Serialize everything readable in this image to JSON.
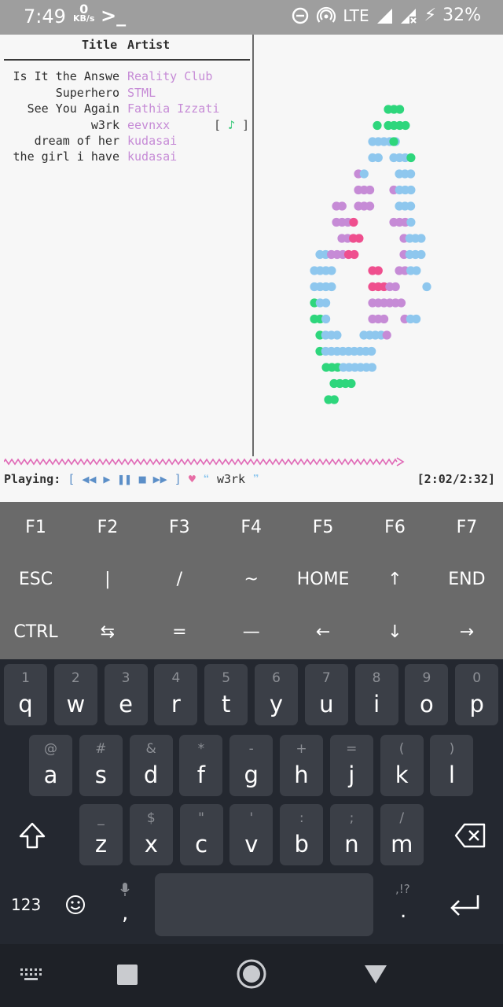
{
  "status_bar": {
    "time": "7:49",
    "net_speed": "0",
    "net_unit": "KB/s",
    "terminal_glyph": ">_",
    "network": "LTE",
    "battery": "32%"
  },
  "terminal": {
    "header": {
      "title": "Title",
      "artist": "Artist"
    },
    "rows": [
      {
        "title": "Is It the Answe",
        "artist": "Reality Club",
        "badge": ""
      },
      {
        "title": "Superhero",
        "artist": "STML",
        "badge": ""
      },
      {
        "title": "See You Again",
        "artist": "Fathia Izzati",
        "badge": ""
      },
      {
        "title": "w3rk",
        "artist": "eevnxx",
        "badge": "[ ♪ ]"
      },
      {
        "title": "dream of her",
        "artist": "kudasai",
        "badge": ""
      },
      {
        "title": "the girl i have",
        "artist": "kudasai",
        "badge": ""
      }
    ],
    "playing_label": "Playing:",
    "controls": "[ ◀◀ ▶ ❚❚ ■ ▶▶ ]",
    "heart": "♥",
    "open_quote": "❝",
    "current_title": "w3rk",
    "close_quote": "❞",
    "elapsed": "[2:02/2:32]",
    "colors": {
      "green": "#2ed67c",
      "blue": "#8ec7ee",
      "purple": "#c68bd6",
      "pink": "#ef4f8e"
    }
  },
  "extra_keys": {
    "row1": [
      "F1",
      "F2",
      "F3",
      "F4",
      "F5",
      "F6",
      "F7"
    ],
    "row2": [
      "ESC",
      "|",
      "/",
      "~",
      "HOME",
      "↑",
      "END"
    ],
    "row3": [
      "CTRL",
      "⇆",
      "=",
      "—",
      "←",
      "↓",
      "→"
    ]
  },
  "keyboard": {
    "row1": [
      {
        "sub": "1",
        "main": "q"
      },
      {
        "sub": "2",
        "main": "w"
      },
      {
        "sub": "3",
        "main": "e"
      },
      {
        "sub": "4",
        "main": "r"
      },
      {
        "sub": "5",
        "main": "t"
      },
      {
        "sub": "6",
        "main": "y"
      },
      {
        "sub": "7",
        "main": "u"
      },
      {
        "sub": "8",
        "main": "i"
      },
      {
        "sub": "9",
        "main": "o"
      },
      {
        "sub": "0",
        "main": "p"
      }
    ],
    "row2": [
      {
        "sub": "@",
        "main": "a"
      },
      {
        "sub": "#",
        "main": "s"
      },
      {
        "sub": "&",
        "main": "d"
      },
      {
        "sub": "*",
        "main": "f"
      },
      {
        "sub": "-",
        "main": "g"
      },
      {
        "sub": "+",
        "main": "h"
      },
      {
        "sub": "=",
        "main": "j"
      },
      {
        "sub": "(",
        "main": "k"
      },
      {
        "sub": ")",
        "main": "l"
      }
    ],
    "row3": [
      {
        "sub": "_",
        "main": "z"
      },
      {
        "sub": "$",
        "main": "x"
      },
      {
        "sub": "\"",
        "main": "c"
      },
      {
        "sub": "'",
        "main": "v"
      },
      {
        "sub": ":",
        "main": "b"
      },
      {
        "sub": ";",
        "main": "n"
      },
      {
        "sub": "/",
        "main": "m"
      }
    ],
    "num_label": "123",
    "comma": ",",
    "period": ".",
    "period_sub": ",!?"
  }
}
